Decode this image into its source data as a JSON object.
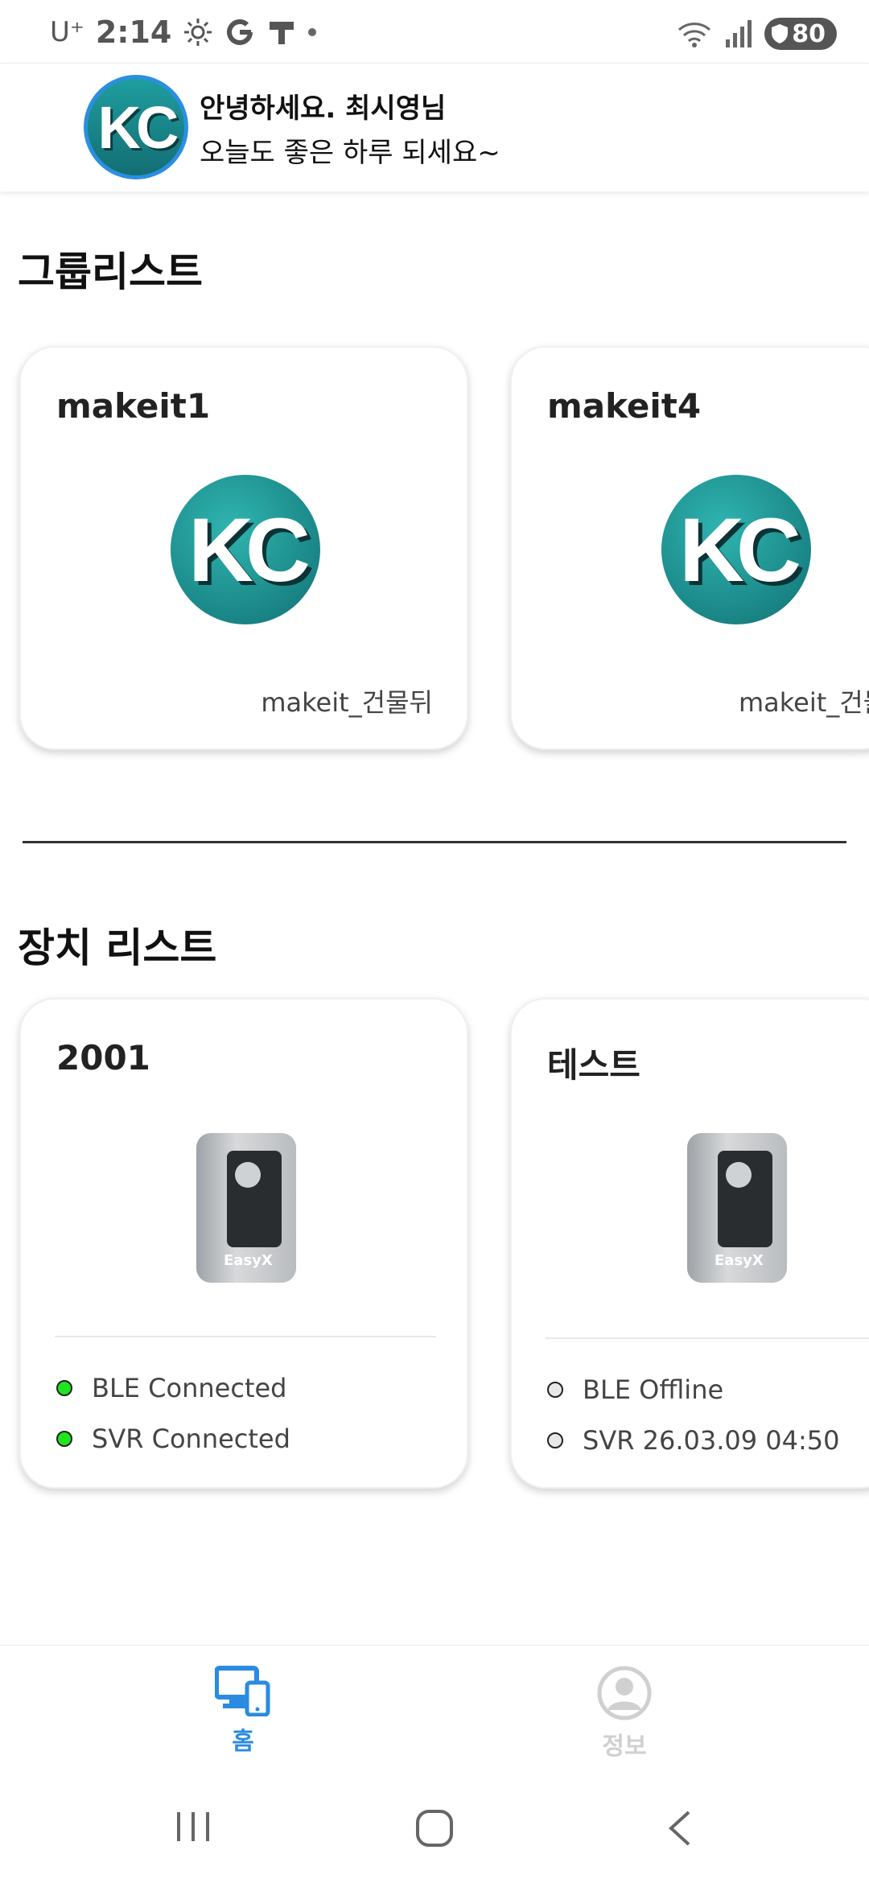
{
  "status_bar": {
    "carrier": "U⁺",
    "time": "2:14",
    "battery": "80"
  },
  "header": {
    "avatar_text": "KC",
    "greeting_line1": "안녕하세요. 최시영님",
    "greeting_line2": "오늘도 좋은 하루 되세요~"
  },
  "groups": {
    "title": "그룹리스트",
    "items": [
      {
        "name": "makeit1",
        "logo_text": "KC",
        "subtitle": "makeit_건물뒤"
      },
      {
        "name": "makeit4",
        "logo_text": "KC",
        "subtitle": "makeit_건물"
      }
    ]
  },
  "devices": {
    "title": "장치 리스트",
    "items": [
      {
        "name": "2001",
        "ble": "BLE Connected",
        "svr": "SVR Connected",
        "ble_state": "on",
        "svr_state": "on"
      },
      {
        "name": "테스트",
        "ble": "BLE Offline",
        "svr": "SVR 26.03.09 04:50",
        "ble_state": "off",
        "svr_state": "off"
      }
    ],
    "device_label": "EasyX"
  },
  "bottom_nav": {
    "home_label": "홈",
    "info_label": "정보",
    "active_color": "#2a8be0",
    "inactive_color": "#d0d0d0"
  }
}
